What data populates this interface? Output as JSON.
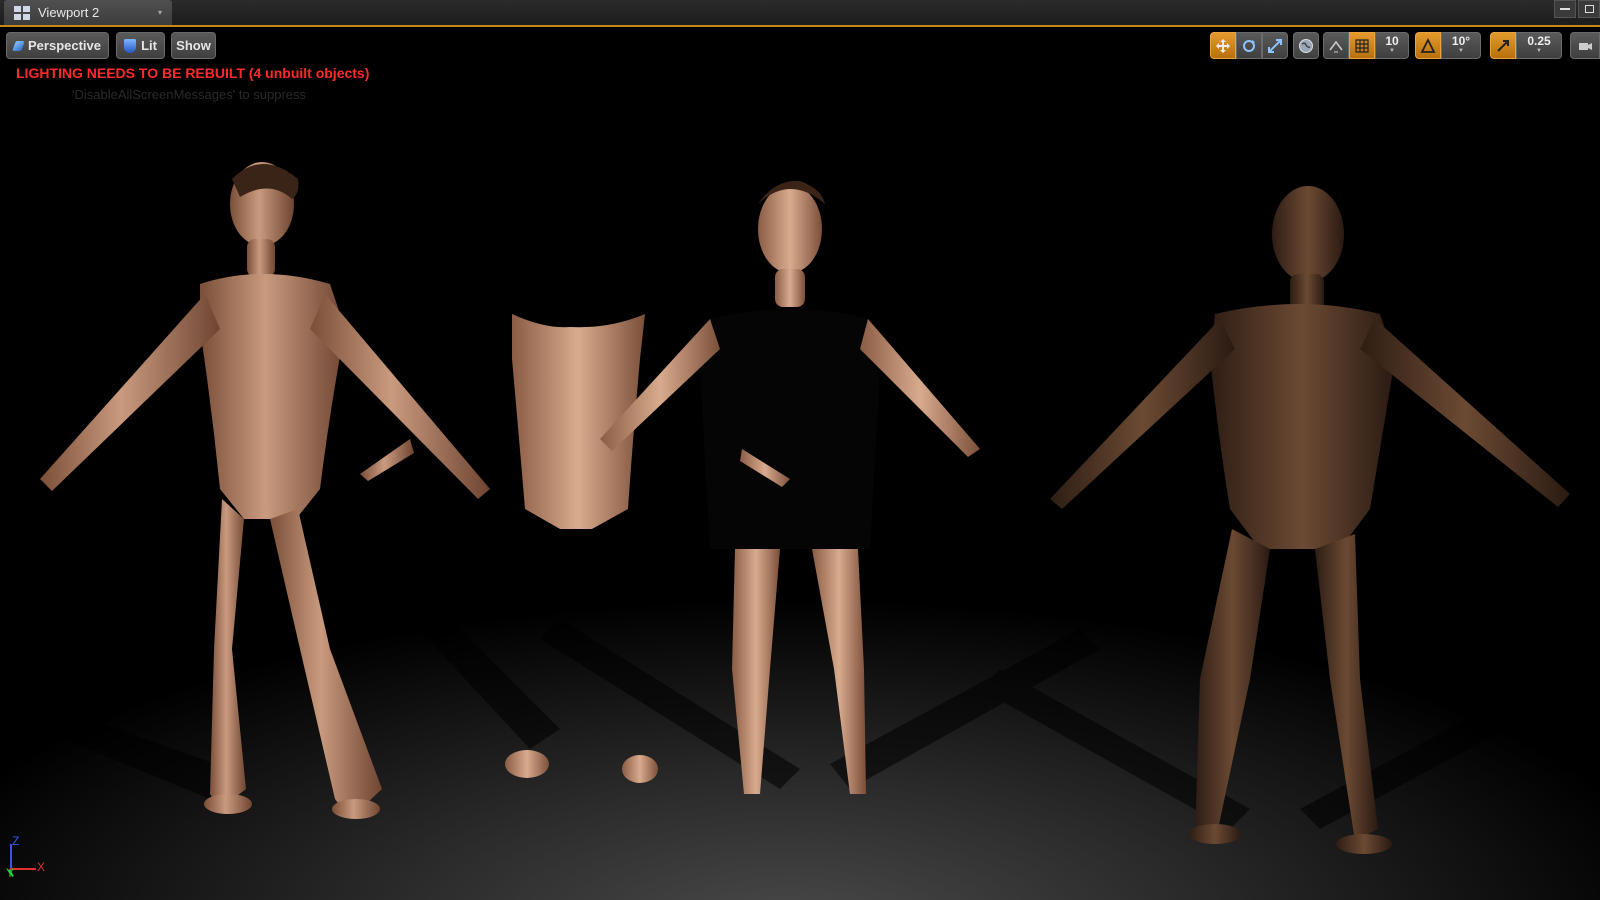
{
  "window": {
    "tab_title": "Viewport 2"
  },
  "toolbar_left": {
    "perspective_label": "Perspective",
    "lit_label": "Lit",
    "show_label": "Show"
  },
  "toolbar_right": {
    "grid_snap_value": "10",
    "rotation_snap_value": "10°",
    "scale_snap_value": "0.25",
    "icons": [
      "translate-icon",
      "rotate-icon",
      "scale-icon",
      "world-icon",
      "surface-snap-icon",
      "grid-icon",
      "angle-icon",
      "scale-snap-icon",
      "camera-speed-icon"
    ],
    "accent_color": "#d98c1c"
  },
  "messages": {
    "warning": "LIGHTING NEEDS TO BE REBUILT (4 unbuilt objects)",
    "suppress_hint": "'DisableAllScreenMessages' to suppress",
    "warning_color": "#ff2b2b"
  },
  "axis": {
    "x": "X",
    "y": "Y",
    "z": "Z"
  }
}
